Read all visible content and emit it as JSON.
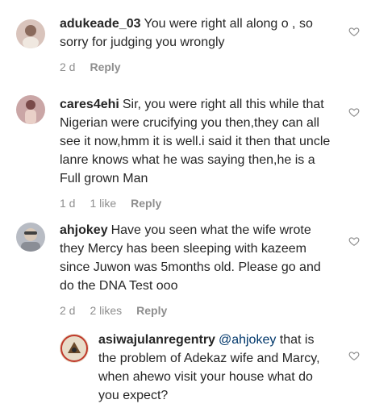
{
  "comments": [
    {
      "username": "adukeade_03",
      "text": "You were right all along o , so sorry for judging you wrongly",
      "time": "2 d",
      "likes": "",
      "reply": "Reply",
      "avatar_color": "#d9c4bc"
    },
    {
      "username": "cares4ehi",
      "text": "Sir, you were right all this while that Nigerian were crucifying you then,they can all see it now,hmm it is well.i said it then that uncle lanre knows what he was saying then,he is a Full grown Man",
      "time": "1 d",
      "likes": "1 like",
      "reply": "Reply",
      "avatar_color": "#caa6a6"
    },
    {
      "username": "ahjokey",
      "text": "Have you seen what the wife wrote they Mercy has been sleeping with kazeem since Juwon was 5months old. Please go and do the DNA Test ooo",
      "time": "2 d",
      "likes": "2 likes",
      "reply": "Reply",
      "avatar_color": "#b8bcc4"
    },
    {
      "username": "asiwajulanregentry",
      "mention": "@ahjokey",
      "text": "that is the problem of Adekaz wife and Marcy, when ahewo visit your house what do you expect?",
      "avatar_color": "#e8dcc8"
    }
  ],
  "colors": {
    "text": "#262626",
    "meta": "#8e8e8e",
    "mention": "#00376b",
    "heart": "#8e8e8e"
  }
}
